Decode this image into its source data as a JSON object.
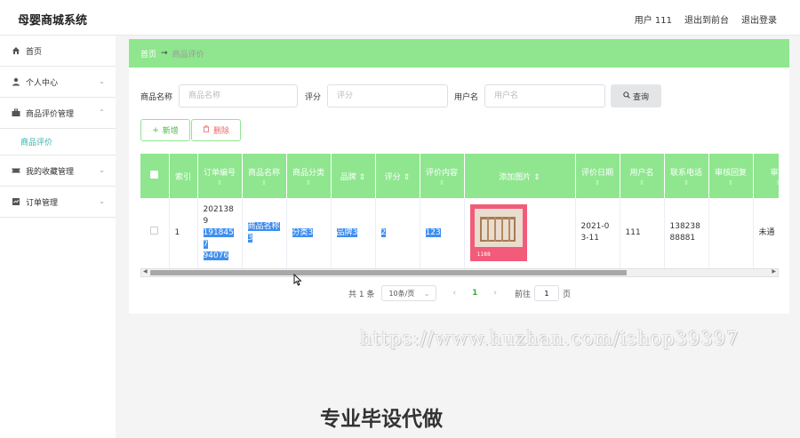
{
  "header": {
    "title": "母婴商城系统",
    "user": "用户 111",
    "back_front": "退出到前台",
    "logout": "退出登录"
  },
  "sidebar": {
    "items": [
      {
        "label": "首页",
        "icon": "home-icon"
      },
      {
        "label": "个人中心",
        "icon": "user-icon"
      },
      {
        "label": "商品评价管理",
        "icon": "briefcase-icon"
      },
      {
        "label": "商品评价",
        "sub": true
      },
      {
        "label": "我的收藏管理",
        "icon": "ticket-icon"
      },
      {
        "label": "订单管理",
        "icon": "order-icon"
      }
    ]
  },
  "breadcrumb": {
    "home": "首页",
    "current": "商品评价"
  },
  "search": {
    "name_label": "商品名称",
    "name_placeholder": "商品名称",
    "score_label": "评分",
    "score_placeholder": "评分",
    "user_label": "用户名",
    "user_placeholder": "用户名",
    "query_button": "查询"
  },
  "actions": {
    "add": "新增",
    "delete": "删除"
  },
  "table": {
    "columns": [
      "索引",
      "订单编号",
      "商品名称",
      "商品分类",
      "品牌",
      "评分",
      "评价内容",
      "添加图片",
      "评价日期",
      "用户名",
      "联系电话",
      "审核回复",
      "审核"
    ],
    "rows": [
      {
        "index": "1",
        "order_no_plain": "2021389",
        "order_no_selected_1": "1918457",
        "order_no_selected_2": "94076",
        "product_name": "商品名称3",
        "category": "分类3",
        "brand": "品牌3",
        "score": "2",
        "content": "123",
        "date": "2021-03-11",
        "username": "111",
        "phone": "13823888881",
        "reply": "",
        "status": "未通"
      }
    ]
  },
  "thumbnail_text": "1188",
  "pagination": {
    "total": "共 1 条",
    "page_size": "10条/页",
    "current_page": "1",
    "goto_label": "前往",
    "goto_value": "1",
    "page_unit": "页"
  },
  "watermark": "https://www.huzhan.com/ishop39397",
  "caption": "专业毕设代做",
  "colors": {
    "accent_green": "#8fe68f",
    "selection_blue": "#3f8ef0",
    "sub_menu_teal": "#36b3a7"
  }
}
